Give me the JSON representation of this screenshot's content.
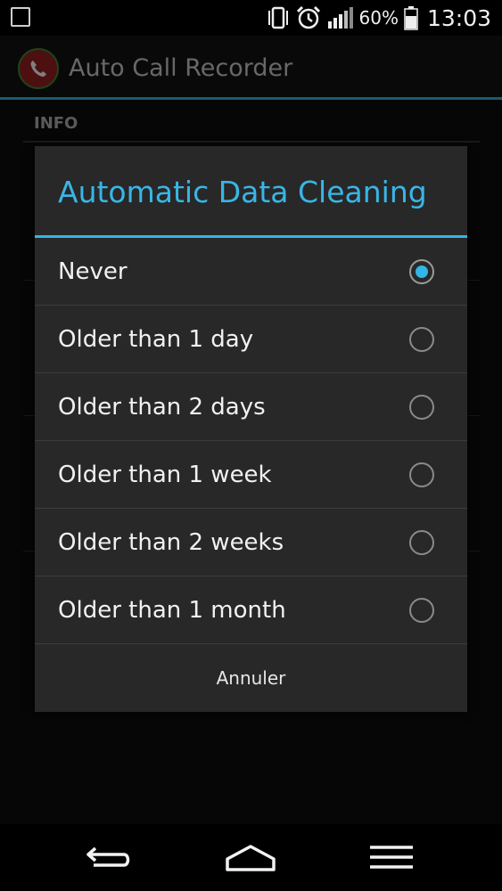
{
  "status_bar": {
    "battery_percent": "60%",
    "time": "13:03",
    "icons": [
      "image-icon",
      "vibrate-icon",
      "alarm-icon",
      "signal-icon",
      "battery-icon"
    ]
  },
  "action_bar": {
    "title": "Auto Call Recorder",
    "icon": "app-phone-icon"
  },
  "background": {
    "section_header": "INFO"
  },
  "dialog": {
    "title": "Automatic Data Cleaning",
    "options": [
      {
        "label": "Never",
        "checked": true
      },
      {
        "label": "Older than 1 day",
        "checked": false
      },
      {
        "label": "Older than 2 days",
        "checked": false
      },
      {
        "label": "Older than 1 week",
        "checked": false
      },
      {
        "label": "Older than 2 weeks",
        "checked": false
      },
      {
        "label": "Older than 1 month",
        "checked": false
      }
    ],
    "cancel_label": "Annuler"
  },
  "nav_bar": {
    "icons": [
      "back-icon",
      "home-icon",
      "menu-icon"
    ]
  },
  "colors": {
    "accent": "#33b5e5",
    "dialog_bg": "#282828",
    "app_icon_red": "#8a1e1e"
  }
}
